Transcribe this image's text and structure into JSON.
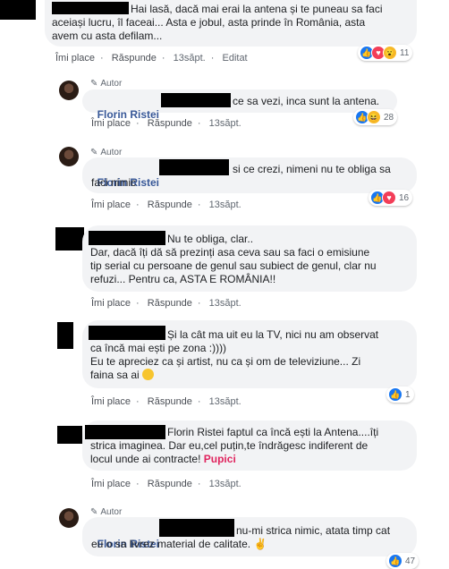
{
  "actions": {
    "like": "Îmi place",
    "reply": "Răspunde",
    "dot": "·",
    "edited": "Editat"
  },
  "author_badge": "Autor",
  "comments": [
    {
      "text": "Hai lasă, dacă mai erai la antena și te puneau sa faci\naceiași lucru, îl faceai... Asta e jobul, asta prinde în România, asta\navem cu asta defilam...",
      "time": "13săpt.",
      "reactions": {
        "icons": [
          "like-icon",
          "love-icon",
          "wow-icon"
        ],
        "count": "11"
      }
    },
    {
      "name": "Florin Ristei",
      "text": "ce sa vezi, inca sunt la antena.",
      "time": "13săpt.",
      "reactions": {
        "icons": [
          "like-icon",
          "haha-icon"
        ],
        "count": "28"
      }
    },
    {
      "name": "Florin Ristei",
      "text_line1": "si ce crezi, nimeni nu te obliga sa",
      "text_line2": "faci nimic",
      "time": "13săpt.",
      "reactions": {
        "icons": [
          "like-icon",
          "love-icon"
        ],
        "count": "16"
      }
    },
    {
      "text_line1": "Nu te obliga, clar..",
      "text_rest": "Dar, dacă îți dă să prezinți asa ceva sau sa faci o emisiune\ntip serial cu persoane de genul sau subiect de genul, clar nu\nrefuzi... Pentru ca, ASTA E ROMÂNIA!!",
      "time": "13săpt."
    },
    {
      "text_line1": "Și la cât ma uit eu la TV, nici nu am observat",
      "text_rest": "ca încă mai ești pe zona :))))\nEu te apreciez ca și artist, nu ca și om de televiziune... Zi\nfaina sa ai",
      "time": "13săpt.",
      "reactions": {
        "icons": [
          "like-icon"
        ],
        "count": "1"
      }
    },
    {
      "text_line1": "Florin Ristei faptul ca încă ești la Antena....îți",
      "text_rest": "strica imaginea. Dar eu,cel puțin,te îndrăgesc indiferent de\nlocul unde ai contracte!",
      "tag": "Pupici",
      "time": "13săpt."
    },
    {
      "name": "Florin Ristei",
      "text_line1": "nu-mi strica nimic, atata timp cat",
      "text_line2": "eu o sa livrez material de calitate.",
      "reactions": {
        "count": "47"
      }
    }
  ]
}
